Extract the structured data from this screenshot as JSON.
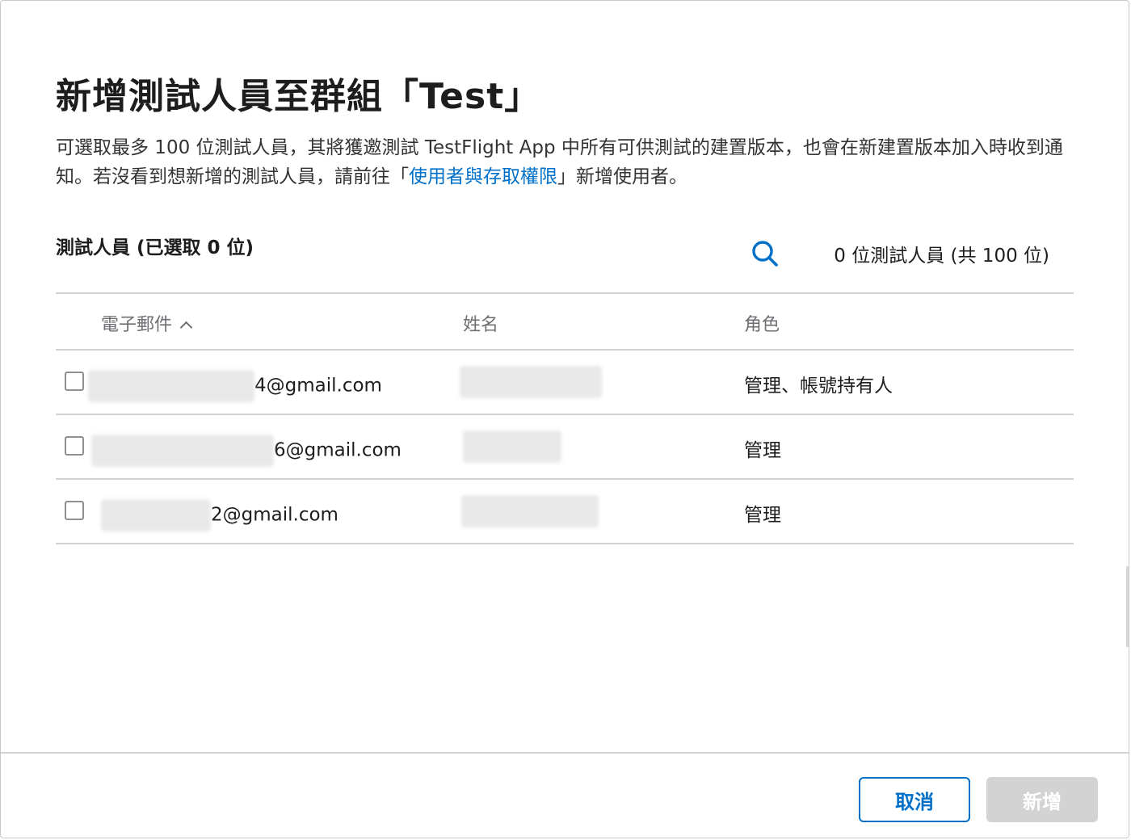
{
  "dialog": {
    "title": "新增測試人員至群組「Test」",
    "description_before": "可選取最多 100 位測試人員，其將獲邀測試 TestFlight App 中所有可供測試的建置版本，也會在新建置版本加入時收到通知。若沒看到想新增的測試人員，請前往「",
    "description_link": "使用者與存取權限",
    "description_after": "」新增使用者。"
  },
  "testers": {
    "section_label": "測試人員 (已選取 0 位)",
    "count_text": "0 位測試人員 (共 100 位)",
    "search_icon": "search-icon"
  },
  "table": {
    "columns": {
      "email": "電子郵件",
      "name": "姓名",
      "role": "角色"
    },
    "sort": {
      "column": "email",
      "direction": "ascending"
    },
    "rows": [
      {
        "email_visible": "4@gmail.com",
        "name_visible": "",
        "role": "管理、帳號持有人",
        "checked": false
      },
      {
        "email_visible": "6@gmail.com",
        "name_visible": "",
        "role": "管理",
        "checked": false
      },
      {
        "email_visible": "2@gmail.com",
        "name_visible": "",
        "role": "管理",
        "checked": false
      }
    ]
  },
  "footer": {
    "cancel_label": "取消",
    "add_label": "新增"
  },
  "colors": {
    "accent": "#0070c9",
    "disabled_button": "#d3d3d3",
    "divider": "#d2d2d2"
  }
}
